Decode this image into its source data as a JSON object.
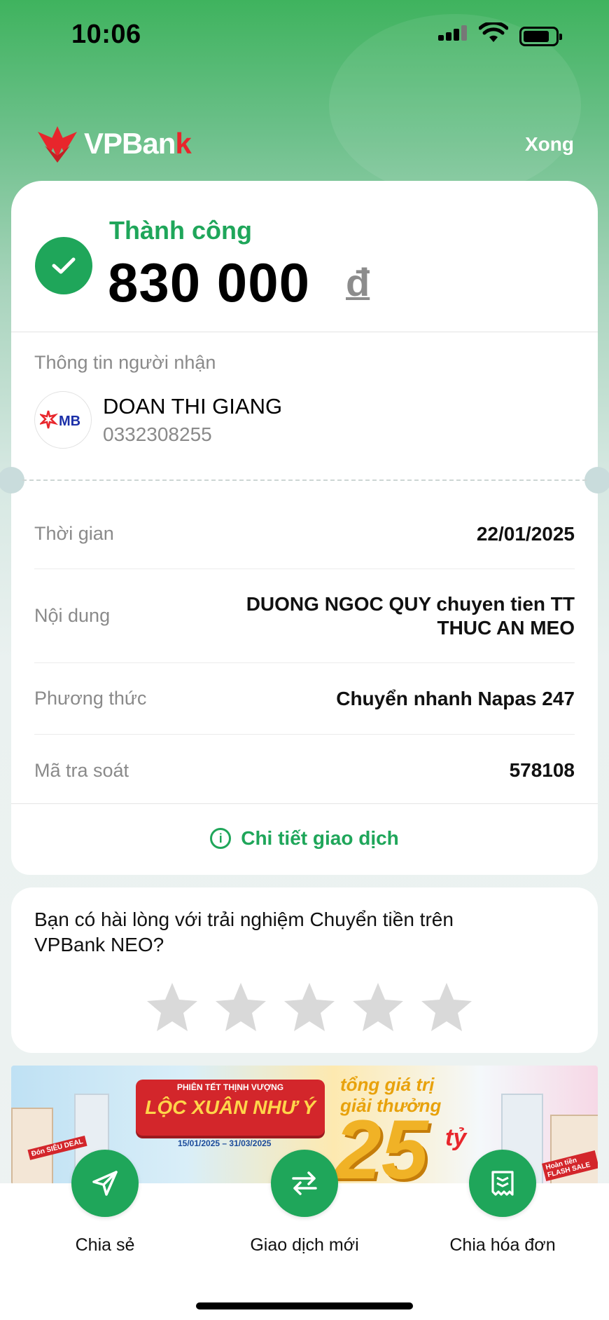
{
  "status_bar": {
    "time": "10:06"
  },
  "header": {
    "brand_name": "VPBan",
    "brand_k": "k",
    "done_label": "Xong"
  },
  "result": {
    "status": "Thành công",
    "amount": "830 000",
    "currency": "đ"
  },
  "recipient": {
    "section_label": "Thông tin người nhận",
    "bank_logo_text": "MB",
    "name": "DOAN THI GIANG",
    "account": "0332308255"
  },
  "details": [
    {
      "label": "Thời gian",
      "value": "22/01/2025"
    },
    {
      "label": "Nội dung",
      "value": "DUONG NGOC QUY chuyen tien TT THUC AN MEO"
    },
    {
      "label": "Phương thức",
      "value": "Chuyển nhanh Napas 247"
    },
    {
      "label": "Mã tra soát",
      "value": "578108"
    }
  ],
  "detail_link": {
    "icon": "info-icon",
    "label": "Chi tiết giao dịch"
  },
  "survey": {
    "question": "Bạn có hài lòng với trải nghiệm Chuyển tiền trên VPBank NEO?",
    "rating": 0,
    "max_rating": 5
  },
  "banner": {
    "subtitle": "PHIÊN TẾT THỊNH VƯỢNG",
    "title": "LỘC XUÂN NHƯ Ý",
    "date_range": "15/01/2025 – 31/03/2025",
    "prize_line1": "tổng giá trị",
    "prize_line2": "giải thưởng",
    "prize_amount": "25",
    "prize_unit": "tỷ",
    "tag_left": "Đón SIÊU DEAL",
    "tag_right": "Hoàn tiền FLASH SALE"
  },
  "actions": [
    {
      "icon": "send-icon",
      "label": "Chia sẻ"
    },
    {
      "icon": "swap-icon",
      "label": "Giao dịch mới"
    },
    {
      "icon": "receipt-icon",
      "label": "Chia hóa đơn"
    }
  ],
  "colors": {
    "accent": "#1fa65a",
    "brand_red": "#e8262c",
    "muted": "#8a8a8a"
  }
}
